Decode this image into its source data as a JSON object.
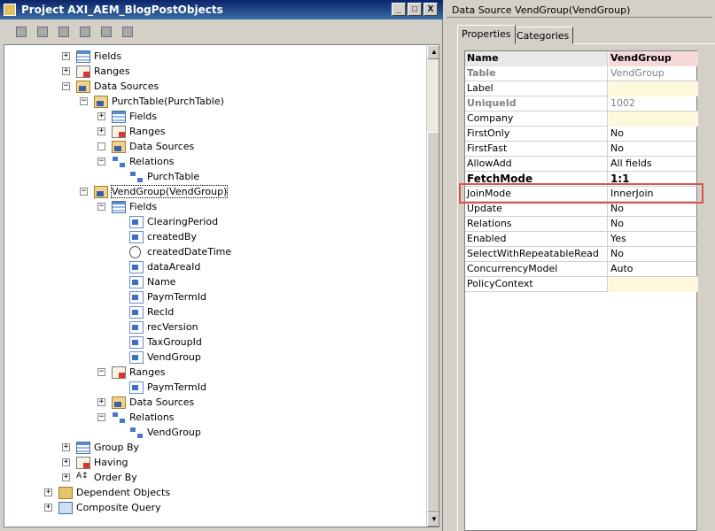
{
  "project_window": {
    "title": "Project AXI_AEM_BlogPostObjects",
    "caption_buttons": [
      "_",
      "□",
      "X"
    ]
  },
  "tree": [
    {
      "label": "Fields",
      "icon": "fields-icon",
      "exp": "+"
    },
    {
      "label": "Ranges",
      "icon": "ranges-icon",
      "exp": "+"
    },
    {
      "label": "Data Sources",
      "icon": "datasource-icon",
      "exp": "−"
    },
    {
      "label": "PurchTable(PurchTable)",
      "icon": "datasource-icon",
      "exp": "−"
    },
    {
      "label": "Fields",
      "icon": "fields-icon",
      "exp": "+"
    },
    {
      "label": "Ranges",
      "icon": "ranges-icon",
      "exp": "+"
    },
    {
      "label": "Data Sources",
      "icon": "datasource-icon",
      "exp": ""
    },
    {
      "label": "Relations",
      "icon": "relations-icon",
      "exp": "−"
    },
    {
      "label": "PurchTable",
      "icon": "relation-icon",
      "exp": null
    },
    {
      "label": "VendGroup(VendGroup)",
      "icon": "datasource-icon",
      "exp": "−"
    },
    {
      "label": "Fields",
      "icon": "fields-icon",
      "exp": "−"
    },
    {
      "label": "ClearingPeriod",
      "icon": "field-icon",
      "exp": null
    },
    {
      "label": "createdBy",
      "icon": "field-icon",
      "exp": null
    },
    {
      "label": "createdDateTime",
      "icon": "clock-icon",
      "exp": null
    },
    {
      "label": "dataAreaId",
      "icon": "field-icon",
      "exp": null
    },
    {
      "label": "Name",
      "icon": "field-icon",
      "exp": null
    },
    {
      "label": "PaymTermId",
      "icon": "field-icon",
      "exp": null
    },
    {
      "label": "RecId",
      "icon": "field-icon",
      "exp": null
    },
    {
      "label": "recVersion",
      "icon": "field-icon",
      "exp": null
    },
    {
      "label": "TaxGroupId",
      "icon": "field-icon",
      "exp": null
    },
    {
      "label": "VendGroup",
      "icon": "field-icon",
      "exp": null
    },
    {
      "label": "Ranges",
      "icon": "ranges-icon",
      "exp": "−"
    },
    {
      "label": "PaymTermId",
      "icon": "field-icon",
      "exp": null
    },
    {
      "label": "Data Sources",
      "icon": "datasource-icon",
      "exp": "+"
    },
    {
      "label": "Relations",
      "icon": "relations-icon",
      "exp": "−"
    },
    {
      "label": "VendGroup",
      "icon": "relation-icon",
      "exp": null
    },
    {
      "label": "Group By",
      "icon": "fields-icon",
      "exp": "+"
    },
    {
      "label": "Having",
      "icon": "ranges-icon",
      "exp": "+"
    },
    {
      "label": "Order By",
      "icon": "order-icon",
      "exp": "+"
    },
    {
      "label": "Dependent Objects",
      "icon": "dependent-icon",
      "exp": "+"
    },
    {
      "label": "Composite Query",
      "icon": "composite-icon",
      "exp": "+"
    }
  ],
  "properties_window": {
    "title": "Data Source VendGroup(VendGroup)",
    "tabs": [
      "Properties",
      "Categories"
    ],
    "header": {
      "name": "Name",
      "value": "VendGroup"
    },
    "rows": [
      {
        "name": "Table",
        "value": "VendGroup"
      },
      {
        "name": "Label",
        "value": ""
      },
      {
        "name": "UniqueId",
        "value": "1002"
      },
      {
        "name": "Company",
        "value": ""
      },
      {
        "name": "FirstOnly",
        "value": "No"
      },
      {
        "name": "FirstFast",
        "value": "No"
      },
      {
        "name": "AllowAdd",
        "value": "All fields"
      },
      {
        "name": "FetchMode",
        "value": "1:1"
      },
      {
        "name": "JoinMode",
        "value": "InnerJoin"
      },
      {
        "name": "Update",
        "value": "No"
      },
      {
        "name": "Relations",
        "value": "No"
      },
      {
        "name": "Enabled",
        "value": "Yes"
      },
      {
        "name": "SelectWithRepeatableRead",
        "value": "No"
      },
      {
        "name": "ConcurrencyModel",
        "value": "Auto"
      },
      {
        "name": "PolicyContext",
        "value": ""
      }
    ]
  },
  "colors": {
    "highlight_border": "#d9534f",
    "title_bar": "#0a246a"
  }
}
